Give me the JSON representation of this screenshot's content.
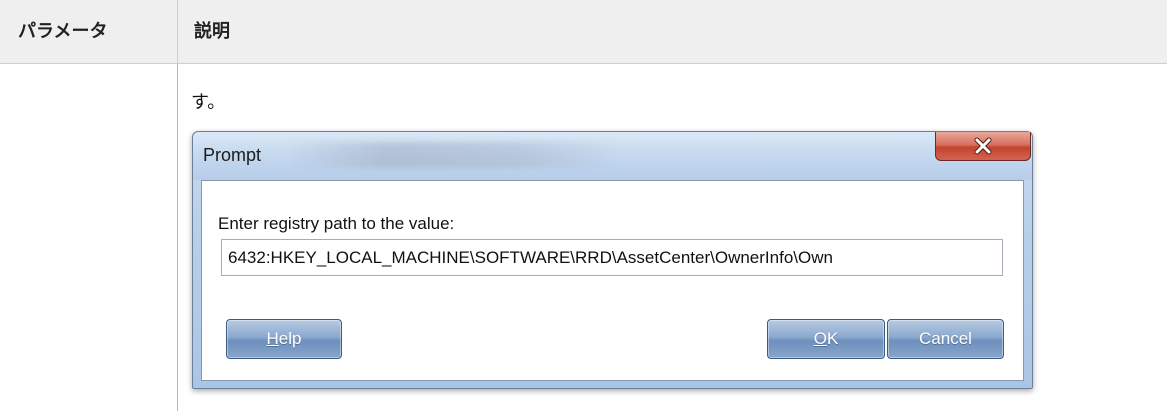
{
  "table": {
    "headers": [
      "パラメータ",
      "説明"
    ],
    "row_text": "す。"
  },
  "dialog": {
    "title": "Prompt",
    "close_label": "X",
    "prompt_label": "Enter registry path to the value:",
    "input_value": "6432:HKEY_LOCAL_MACHINE\\SOFTWARE\\RRD\\AssetCenter\\OwnerInfo\\Own",
    "buttons": {
      "help": {
        "mnemonic": "H",
        "rest": "elp"
      },
      "ok": {
        "mnemonic": "O",
        "rest": "K"
      },
      "cancel": "Cancel"
    }
  }
}
